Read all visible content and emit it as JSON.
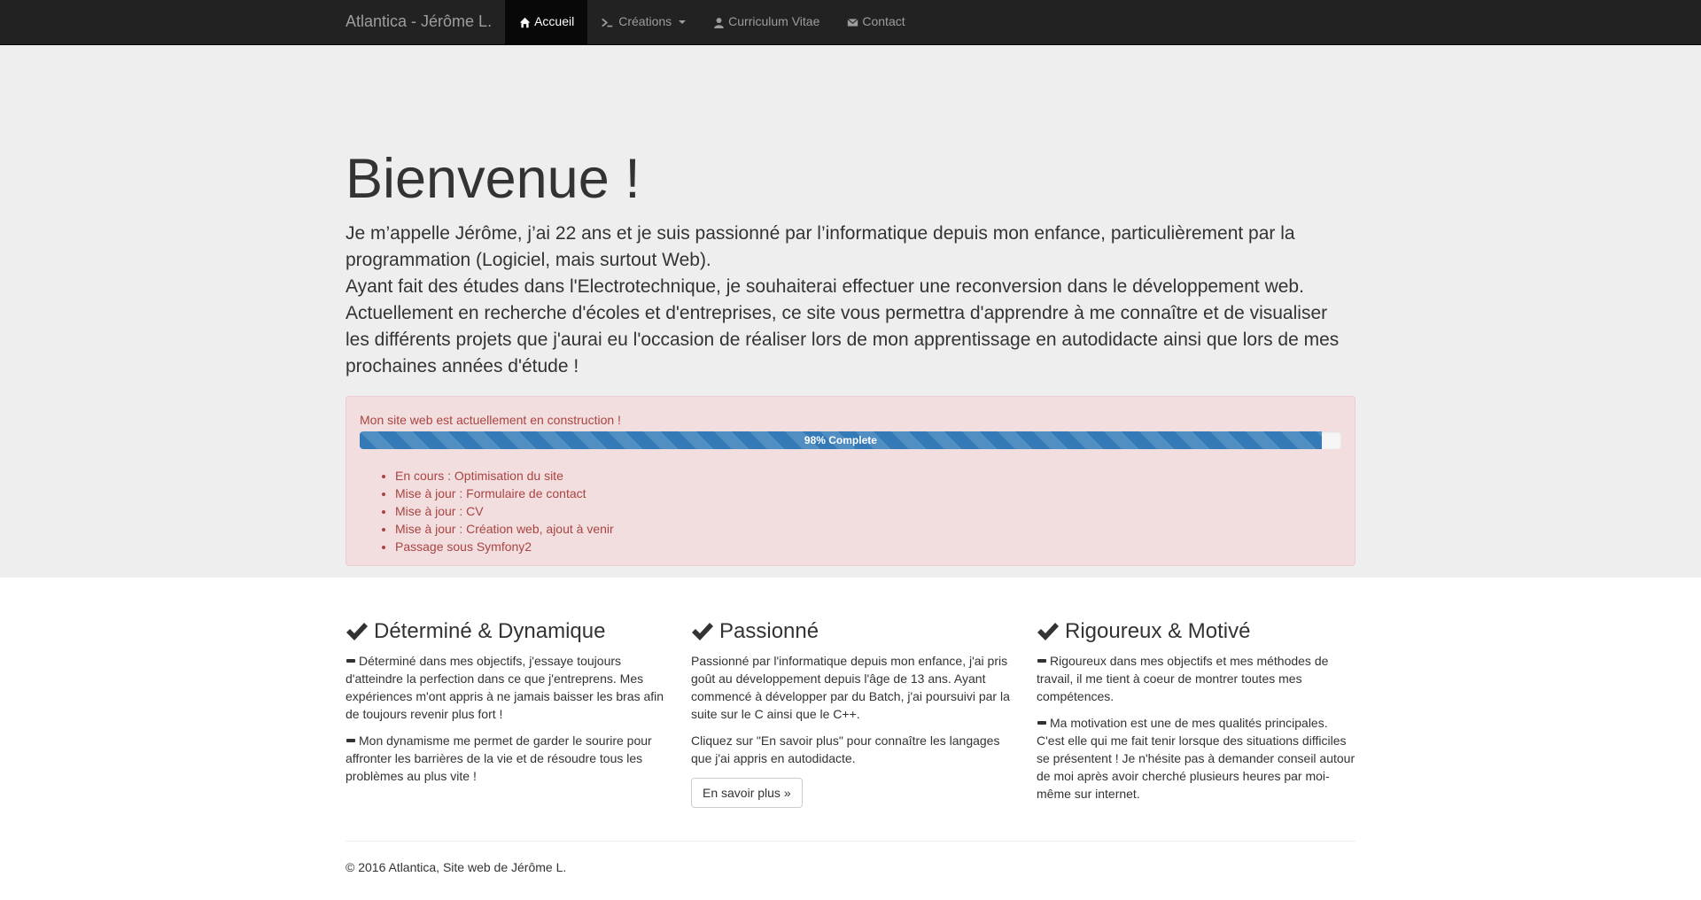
{
  "navbar": {
    "brand": "Atlantica - Jérôme L.",
    "items": [
      {
        "label": "Accueil",
        "icon": "home-icon",
        "active": true
      },
      {
        "label": "Créations",
        "icon": "terminal-icon",
        "active": false,
        "dropdown": true
      },
      {
        "label": "Curriculum Vitae",
        "icon": "user-icon",
        "active": false
      },
      {
        "label": "Contact",
        "icon": "envelope-icon",
        "active": false
      }
    ]
  },
  "jumbotron": {
    "title": "Bienvenue !",
    "lines": [
      "Je m’appelle Jérôme, j’ai 22 ans et je suis passionné par l’informatique depuis mon enfance, particulièrement par la programmation (Logiciel, mais surtout Web).",
      "Ayant fait des études dans l'Electrotechnique, je souhaiterai effectuer une reconversion dans le développement web. Actuellement en recherche d'écoles et d'entreprises, ce site vous permettra d'apprendre à me connaître et de visualiser les différents projets que j'aurai eu l'occasion de réaliser lors de mon apprentissage en autodidacte ainsi que lors de mes prochaines années d'étude !"
    ]
  },
  "alert": {
    "title": "Mon site web est actuellement en construction !",
    "progress_label": "98% Complete",
    "progress_value": 98,
    "items": [
      "En cours : Optimisation du site",
      "Mise à jour : Formulaire de contact",
      "Mise à jour : CV",
      "Mise à jour : Création web, ajout à venir",
      "Passage sous Symfony2"
    ]
  },
  "features": [
    {
      "title": "Déterminé & Dynamique",
      "paragraphs": [
        "Déterminé dans mes objectifs, j'essaye toujours d'atteindre la perfection dans ce que j'entreprens. Mes expériences m'ont appris à ne jamais baisser les bras afin de toujours revenir plus fort !",
        "Mon dynamisme me permet de garder le sourire pour affronter les barrières de la vie et de résoudre tous les problèmes au plus vite !"
      ]
    },
    {
      "title": "Passionné",
      "paragraphs": [
        "Passionné par l'informatique depuis mon enfance, j'ai pris goût au développement depuis l'âge de 13 ans. Ayant commencé à développer par du Batch, j'ai poursuivi par la suite sur le C ainsi que le C++.",
        "Cliquez sur \"En savoir plus\" pour connaître les langages que j'ai appris en autodidacte."
      ],
      "button": "En savoir plus »"
    },
    {
      "title": "Rigoureux & Motivé",
      "paragraphs": [
        "Rigoureux dans mes objectifs et mes méthodes de travail, il me tient à coeur de montrer toutes mes compétences.",
        "Ma motivation est une de mes qualités principales. C'est elle qui me fait tenir lorsque des situations difficiles se présentent ! Je n'hésite pas à demander conseil autour de moi après avoir cherché plusieurs heures par moi-même sur internet."
      ]
    }
  ],
  "footer": {
    "text": "© 2016 Atlantica, Site web de Jérôme L."
  },
  "colors": {
    "navbar_bg": "#222222",
    "jumbotron_bg": "#eeeeee",
    "alert_bg": "#f2dede",
    "alert_text": "#a94442",
    "progress_bar": "#337ab7"
  }
}
